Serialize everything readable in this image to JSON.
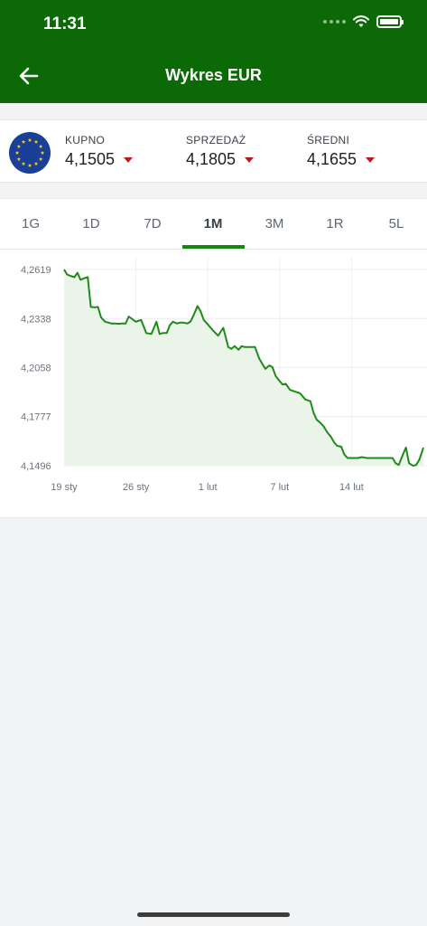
{
  "status_bar": {
    "time": "11:31"
  },
  "header": {
    "title": "Wykres EUR"
  },
  "colors": {
    "header": "#0c6a06",
    "accent": "#18870f",
    "line": "#1f8a1a",
    "down": "#c0161d",
    "area": "#eaf4e8"
  },
  "rates": [
    {
      "label": "KUPNO",
      "value": "4,1505",
      "trend": "down"
    },
    {
      "label": "SPRZEDAŻ",
      "value": "4,1805",
      "trend": "down"
    },
    {
      "label": "ŚREDNI",
      "value": "4,1655",
      "trend": "down"
    }
  ],
  "tabs": [
    {
      "label": "1G"
    },
    {
      "label": "1D"
    },
    {
      "label": "7D"
    },
    {
      "label": "1M",
      "active": true
    },
    {
      "label": "3M"
    },
    {
      "label": "1R"
    },
    {
      "label": "5L"
    }
  ],
  "chart_data": {
    "type": "area",
    "title": "",
    "xlabel": "",
    "ylabel": "",
    "ylim": [
      4.1496,
      4.2619
    ],
    "yticks": [
      "4,2619",
      "4,2338",
      "4,2058",
      "4,1777",
      "4,1496"
    ],
    "ytick_values": [
      4.2619,
      4.2338,
      4.2058,
      4.1777,
      4.1496
    ],
    "xticks": [
      "19 sty",
      "26 sty",
      "1 lut",
      "7 lut",
      "14 lut"
    ],
    "xtick_positions": [
      0,
      7,
      14,
      21,
      28
    ],
    "x_range": [
      0,
      35
    ],
    "grid": true,
    "series": [
      {
        "x": [
          0,
          0.3,
          0.6,
          1,
          1.3,
          1.6,
          2,
          2.3,
          2.6,
          3,
          3.3,
          3.6,
          4,
          4.3,
          4.6,
          5,
          5.3,
          5.6,
          6,
          6.3,
          7,
          7.5,
          8,
          8.5,
          9,
          9.3,
          9.6,
          10,
          10.3,
          10.6,
          11,
          11.3,
          11.6,
          12,
          12.3,
          12.6,
          13,
          13.3,
          13.6,
          14,
          14.5,
          15,
          15.5,
          16,
          16.3,
          16.6,
          17,
          17.3,
          17.6,
          18,
          18.3,
          18.6,
          19,
          19.3,
          19.6,
          20,
          20.3,
          20.6,
          21,
          21.3,
          21.6,
          22,
          22.5,
          23,
          23.5,
          24,
          24.3,
          24.6,
          25,
          25.3,
          25.6,
          26,
          26.3,
          26.6,
          27,
          27.3,
          27.6,
          28,
          28.3,
          28.6,
          29,
          29.5,
          30,
          30.5,
          31,
          31.5,
          32,
          32.3,
          32.6,
          33,
          33.3,
          33.6,
          34,
          34.3,
          34.6,
          35
        ],
        "values": [
          4.2619,
          4.259,
          4.2583,
          4.2575,
          4.26,
          4.256,
          4.257,
          4.2575,
          4.2405,
          4.2402,
          4.2405,
          4.2345,
          4.232,
          4.2315,
          4.231,
          4.231,
          4.2308,
          4.231,
          4.231,
          4.235,
          4.232,
          4.233,
          4.2255,
          4.225,
          4.232,
          4.225,
          4.2255,
          4.2255,
          4.23,
          4.232,
          4.231,
          4.2315,
          4.2315,
          4.231,
          4.232,
          4.2355,
          4.241,
          4.238,
          4.233,
          4.2305,
          4.227,
          4.224,
          4.2285,
          4.2175,
          4.2165,
          4.218,
          4.216,
          4.218,
          4.2175,
          4.2175,
          4.2175,
          4.2175,
          4.211,
          4.208,
          4.205,
          4.207,
          4.206,
          4.201,
          4.198,
          4.196,
          4.1965,
          4.193,
          4.192,
          4.191,
          4.1875,
          4.1865,
          4.18,
          4.176,
          4.174,
          4.172,
          4.169,
          4.166,
          4.163,
          4.161,
          4.1605,
          4.156,
          4.154,
          4.154,
          4.154,
          4.154,
          4.1545,
          4.154,
          4.154,
          4.154,
          4.154,
          4.154,
          4.154,
          4.151,
          4.15,
          4.156,
          4.16,
          4.151,
          4.1496,
          4.15,
          4.153,
          4.16
        ]
      }
    ]
  }
}
